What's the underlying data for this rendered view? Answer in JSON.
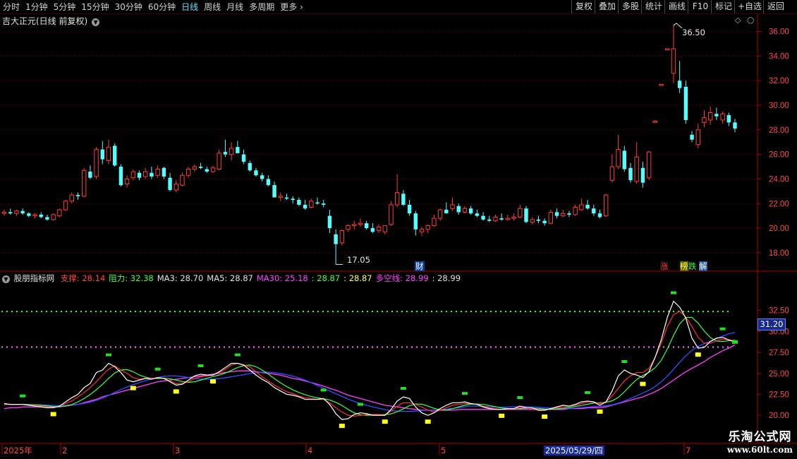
{
  "toolbar": {
    "periods": [
      "分时",
      "1分钟",
      "5分钟",
      "15分钟",
      "30分钟",
      "60分钟",
      "日线",
      "周线",
      "月线",
      "多周期",
      "更多"
    ],
    "selected": "日线",
    "right_buttons": [
      "复权",
      "叠加",
      "多股",
      "统计",
      "画线",
      "F10",
      "标记",
      "+自选",
      "返回"
    ]
  },
  "main_pane": {
    "title": "吉大正元(日线 前复权)",
    "y_ticks": [
      "36.00",
      "34.00",
      "32.00",
      "30.00",
      "28.00",
      "26.00",
      "24.00",
      "22.00",
      "20.00",
      "18.00"
    ],
    "high_label": "36.50",
    "low_label": "17.05",
    "markers": [
      "财",
      "涨",
      "榜",
      "跌",
      "解"
    ]
  },
  "indicator_pane": {
    "name": "股朋指标网",
    "labels": [
      {
        "text": "支撑: 28.14",
        "color": "#ff4040"
      },
      {
        "text": "阻力: 32.38",
        "color": "#40ff40"
      },
      {
        "text": "MA3: 28.70",
        "color": "#e0e0e0"
      },
      {
        "text": "MA5: 28.87",
        "color": "#e0e0e0"
      },
      {
        "text": "MA30: 25.18",
        "color": "#ff40ff"
      },
      {
        "text": ": 28.87",
        "color": "#40ff40"
      },
      {
        "text": ": 28.87",
        "color": "#ffff40"
      },
      {
        "text": "多空线: 28.99",
        "color": "#ff40ff"
      },
      {
        "text": ": 28.99",
        "color": "#e0e0e0"
      }
    ],
    "y_ticks": [
      "32.50",
      "30.00",
      "27.50",
      "25.00",
      "22.50",
      "20.00"
    ],
    "cursor_value": "31.20"
  },
  "time_axis": {
    "labels": [
      "2025年",
      "2",
      "3",
      "4",
      "5",
      "6",
      "7"
    ],
    "cursor_date": "2025/05/29/四"
  },
  "watermark": {
    "line1": "乐淘公式网",
    "line2": "www.60lt.com"
  },
  "colors": {
    "up": "#ff3b3b",
    "down": "#54ffff",
    "grid": "#7a0000",
    "axis": "#b00000"
  },
  "chart_data": {
    "type": "candlestick",
    "ohlc": [
      [
        21.2,
        21.5,
        21.0,
        21.3
      ],
      [
        21.3,
        21.6,
        21.1,
        21.2
      ],
      [
        21.2,
        21.5,
        21.0,
        21.4
      ],
      [
        21.4,
        21.6,
        21.1,
        21.2
      ],
      [
        21.2,
        21.3,
        20.9,
        21.0
      ],
      [
        21.0,
        21.2,
        20.8,
        21.1
      ],
      [
        21.1,
        21.3,
        20.8,
        20.9
      ],
      [
        20.9,
        21.1,
        20.6,
        20.7
      ],
      [
        20.7,
        21.2,
        20.6,
        21.1
      ],
      [
        21.0,
        21.6,
        20.9,
        21.5
      ],
      [
        21.5,
        22.3,
        21.4,
        22.2
      ],
      [
        22.2,
        22.9,
        22.0,
        22.7
      ],
      [
        22.7,
        22.9,
        22.3,
        22.6
      ],
      [
        22.6,
        24.9,
        22.5,
        24.7
      ],
      [
        24.6,
        25.1,
        24.0,
        24.1
      ],
      [
        24.2,
        26.6,
        24.0,
        26.4
      ],
      [
        26.4,
        27.1,
        25.2,
        25.6
      ],
      [
        25.5,
        27.2,
        25.2,
        26.6
      ],
      [
        26.7,
        26.9,
        25.0,
        25.1
      ],
      [
        25.0,
        25.2,
        23.4,
        23.5
      ],
      [
        23.6,
        24.3,
        23.3,
        24.0
      ],
      [
        24.1,
        24.8,
        23.9,
        24.6
      ],
      [
        24.5,
        24.7,
        23.9,
        24.1
      ],
      [
        24.2,
        24.9,
        24.0,
        24.6
      ],
      [
        24.5,
        25.0,
        24.0,
        24.2
      ],
      [
        24.3,
        25.1,
        24.1,
        24.8
      ],
      [
        24.9,
        25.0,
        24.0,
        24.2
      ],
      [
        24.1,
        24.5,
        23.0,
        23.1
      ],
      [
        23.1,
        23.9,
        22.9,
        23.6
      ],
      [
        23.5,
        24.5,
        23.4,
        24.3
      ],
      [
        24.3,
        25.0,
        24.1,
        24.8
      ],
      [
        24.8,
        25.2,
        24.6,
        25.0
      ],
      [
        25.0,
        25.3,
        24.8,
        24.9
      ],
      [
        24.8,
        25.0,
        24.5,
        24.6
      ],
      [
        24.6,
        25.1,
        24.5,
        24.9
      ],
      [
        24.8,
        26.4,
        24.7,
        26.1
      ],
      [
        26.2,
        27.2,
        25.8,
        26.0
      ],
      [
        26.0,
        27.0,
        25.5,
        26.5
      ],
      [
        26.6,
        27.1,
        26.2,
        26.1
      ],
      [
        26.0,
        26.4,
        25.2,
        25.4
      ],
      [
        25.3,
        25.5,
        24.6,
        24.7
      ],
      [
        24.7,
        24.9,
        24.2,
        24.3
      ],
      [
        24.3,
        24.5,
        23.8,
        24.0
      ],
      [
        24.0,
        24.3,
        23.4,
        23.5
      ],
      [
        23.5,
        23.8,
        22.6,
        22.5
      ],
      [
        22.5,
        22.9,
        22.2,
        22.6
      ],
      [
        22.5,
        22.8,
        22.3,
        22.4
      ],
      [
        22.4,
        22.6,
        22.0,
        22.3
      ],
      [
        22.3,
        22.5,
        21.8,
        21.9
      ],
      [
        21.9,
        22.3,
        21.5,
        21.6
      ],
      [
        21.7,
        22.4,
        21.6,
        22.2
      ],
      [
        22.1,
        22.5,
        21.9,
        22.0
      ],
      [
        22.0,
        22.3,
        21.7,
        21.9
      ],
      [
        21.0,
        21.5,
        19.6,
        20.0
      ],
      [
        19.5,
        19.9,
        17.05,
        18.7
      ],
      [
        18.8,
        19.9,
        18.6,
        19.8
      ],
      [
        19.9,
        20.3,
        19.7,
        20.2
      ],
      [
        20.2,
        20.6,
        19.9,
        20.3
      ],
      [
        20.3,
        20.8,
        20.1,
        20.4
      ],
      [
        20.4,
        20.6,
        19.9,
        20.0
      ],
      [
        20.0,
        20.4,
        19.6,
        19.7
      ],
      [
        19.8,
        20.3,
        19.6,
        20.1
      ],
      [
        19.7,
        20.2,
        19.5,
        20.2
      ],
      [
        20.3,
        22.2,
        20.2,
        21.9
      ],
      [
        21.9,
        24.4,
        21.7,
        22.9
      ],
      [
        22.8,
        23.1,
        21.8,
        21.9
      ],
      [
        21.9,
        22.3,
        21.0,
        21.2
      ],
      [
        21.2,
        21.4,
        19.4,
        19.9
      ],
      [
        19.7,
        20.1,
        19.4,
        19.9
      ],
      [
        19.9,
        20.3,
        19.6,
        20.2
      ],
      [
        20.2,
        21.1,
        20.1,
        20.8
      ],
      [
        20.8,
        21.6,
        20.6,
        21.5
      ],
      [
        21.5,
        22.1,
        21.3,
        21.2
      ],
      [
        21.6,
        22.5,
        21.4,
        21.9
      ],
      [
        21.8,
        22.0,
        21.1,
        21.3
      ],
      [
        21.3,
        21.8,
        21.2,
        21.6
      ],
      [
        21.6,
        21.8,
        21.1,
        21.2
      ],
      [
        21.2,
        21.5,
        20.9,
        21.0
      ],
      [
        21.0,
        21.3,
        20.6,
        20.7
      ],
      [
        20.7,
        21.0,
        20.5,
        20.6
      ],
      [
        20.6,
        21.1,
        20.5,
        20.9
      ],
      [
        20.8,
        21.2,
        20.6,
        20.7
      ],
      [
        20.7,
        21.1,
        20.6,
        20.8
      ],
      [
        20.8,
        21.2,
        20.6,
        20.9
      ],
      [
        20.9,
        21.9,
        20.8,
        21.6
      ],
      [
        21.6,
        21.8,
        20.4,
        20.5
      ],
      [
        20.5,
        20.9,
        20.3,
        20.7
      ],
      [
        20.7,
        21.0,
        20.4,
        20.6
      ],
      [
        20.6,
        20.8,
        20.2,
        20.4
      ],
      [
        20.4,
        21.5,
        20.3,
        21.3
      ],
      [
        21.3,
        21.6,
        20.8,
        21.0
      ],
      [
        21.0,
        21.5,
        20.9,
        21.2
      ],
      [
        21.2,
        21.4,
        20.9,
        21.1
      ],
      [
        21.1,
        21.9,
        21.0,
        21.7
      ],
      [
        21.5,
        22.4,
        21.4,
        21.9
      ],
      [
        21.9,
        22.3,
        21.5,
        21.6
      ],
      [
        21.6,
        21.9,
        21.0,
        21.2
      ],
      [
        21.2,
        21.5,
        20.8,
        20.9
      ],
      [
        21.0,
        22.8,
        20.9,
        22.7
      ],
      [
        23.9,
        26.0,
        23.7,
        25.0
      ],
      [
        25.0,
        27.6,
        24.8,
        26.4
      ],
      [
        26.3,
        26.7,
        24.6,
        24.8
      ],
      [
        24.9,
        25.3,
        23.7,
        23.9
      ],
      [
        23.8,
        27.0,
        23.6,
        25.8
      ],
      [
        24.9,
        25.4,
        23.3,
        23.7
      ],
      [
        24.1,
        26.3,
        23.9,
        26.2
      ],
      [
        28.6,
        28.8,
        28.6,
        28.7
      ],
      [
        31.6,
        31.7,
        31.6,
        31.7
      ],
      [
        34.5,
        34.6,
        34.5,
        34.6
      ],
      [
        32.6,
        36.5,
        31.8,
        34.6
      ],
      [
        32.0,
        33.6,
        31.0,
        31.4
      ],
      [
        31.5,
        32.0,
        28.5,
        28.8
      ],
      [
        27.6,
        27.9,
        27.0,
        27.2
      ],
      [
        26.8,
        28.5,
        26.5,
        28.0
      ],
      [
        28.6,
        29.6,
        28.2,
        29.0
      ],
      [
        28.8,
        29.9,
        28.4,
        29.4
      ],
      [
        29.3,
        29.8,
        28.8,
        29.1
      ],
      [
        28.8,
        29.5,
        28.5,
        29.3
      ],
      [
        29.2,
        29.4,
        28.3,
        28.6
      ],
      [
        28.6,
        28.9,
        27.8,
        28.1
      ]
    ],
    "indicator_series": {
      "MA3": [
        21.4,
        21.3,
        21.3,
        21.3,
        21.2,
        21.1,
        21.0,
        20.9,
        20.9,
        21.1,
        21.6,
        22.1,
        22.5,
        23.3,
        23.8,
        25.1,
        25.4,
        26.2,
        25.8,
        25.1,
        24.2,
        24.0,
        24.2,
        24.4,
        24.3,
        24.5,
        24.4,
        24.0,
        23.6,
        23.7,
        24.2,
        24.7,
        24.9,
        24.8,
        24.8,
        25.2,
        25.7,
        26.2,
        26.2,
        26.0,
        25.4,
        24.8,
        24.3,
        23.9,
        23.3,
        22.9,
        22.5,
        22.4,
        22.2,
        21.9,
        21.9,
        21.9,
        22.0,
        21.3,
        20.2,
        19.5,
        19.6,
        20.1,
        20.3,
        20.2,
        20.0,
        20.0,
        20.0,
        20.7,
        21.7,
        22.2,
        22.0,
        21.0,
        20.3,
        20.0,
        20.3,
        20.8,
        21.2,
        21.5,
        21.5,
        21.6,
        21.4,
        21.3,
        21.0,
        20.8,
        20.7,
        20.7,
        20.8,
        20.8,
        21.1,
        20.9,
        20.9,
        20.6,
        20.6,
        20.8,
        21.0,
        21.2,
        21.1,
        21.3,
        21.6,
        21.7,
        21.6,
        21.2,
        21.6,
        22.9,
        24.7,
        25.4,
        25.0,
        24.8,
        24.5,
        25.2,
        26.9,
        29.0,
        31.7,
        33.6,
        32.9,
        31.6,
        29.2,
        28.0,
        28.1,
        28.8,
        29.2,
        29.3,
        29.0,
        28.7
      ],
      "MA5": [
        21.3,
        21.3,
        21.3,
        21.3,
        21.2,
        21.2,
        21.1,
        21.0,
        20.9,
        21.1,
        21.4,
        21.7,
        22.2,
        22.7,
        23.3,
        24.0,
        24.8,
        25.5,
        25.9,
        25.4,
        25.0,
        24.5,
        24.3,
        24.4,
        24.4,
        24.5,
        24.4,
        24.1,
        23.8,
        23.8,
        24.0,
        24.4,
        24.6,
        24.7,
        24.8,
        25.1,
        25.5,
        26.0,
        26.2,
        26.0,
        25.8,
        25.2,
        24.6,
        24.1,
        23.6,
        23.2,
        22.8,
        22.6,
        22.3,
        22.1,
        22.0,
        21.9,
        21.9,
        21.5,
        20.9,
        20.4,
        20.0,
        19.9,
        20.0,
        20.1,
        20.1,
        20.1,
        20.0,
        20.5,
        21.1,
        21.5,
        21.5,
        21.3,
        21.0,
        20.6,
        20.4,
        20.6,
        20.9,
        21.2,
        21.3,
        21.4,
        21.4,
        21.3,
        21.1,
        20.9,
        20.8,
        20.7,
        20.8,
        20.8,
        20.9,
        20.9,
        20.8,
        20.7,
        20.6,
        20.8,
        20.9,
        21.0,
        21.1,
        21.2,
        21.4,
        21.6,
        21.6,
        21.4,
        21.6,
        22.3,
        23.2,
        24.1,
        24.7,
        25.1,
        25.1,
        25.6,
        26.9,
        28.6,
        30.6,
        32.0,
        32.4,
        31.7,
        30.6,
        29.3,
        28.6,
        28.6,
        28.9,
        29.1,
        29.0,
        28.9
      ],
      "MA30": [
        20.8,
        20.9,
        20.9,
        21.0,
        21.0,
        21.0,
        21.0,
        21.0,
        21.0,
        21.0,
        21.1,
        21.2,
        21.3,
        21.5,
        21.7,
        21.9,
        22.2,
        22.4,
        22.6,
        22.8,
        23.0,
        23.2,
        23.4,
        23.6,
        23.8,
        24.0,
        24.1,
        24.2,
        24.3,
        24.4,
        24.5,
        24.6,
        24.7,
        24.8,
        24.9,
        25.0,
        25.1,
        25.2,
        25.3,
        25.3,
        25.3,
        25.2,
        25.1,
        25.0,
        24.9,
        24.8,
        24.6,
        24.4,
        24.3,
        24.1,
        23.9,
        23.7,
        23.5,
        23.2,
        23.0,
        22.7,
        22.4,
        22.2,
        22.0,
        21.8,
        21.6,
        21.4,
        21.2,
        21.1,
        21.0,
        20.9,
        20.8,
        20.7,
        20.6,
        20.6,
        20.6,
        20.6,
        20.6,
        20.6,
        20.7,
        20.7,
        20.7,
        20.7,
        20.7,
        20.7,
        20.7,
        20.7,
        20.7,
        20.7,
        20.7,
        20.7,
        20.7,
        20.7,
        20.7,
        20.7,
        20.7,
        20.7,
        20.8,
        20.8,
        20.8,
        20.9,
        20.9,
        20.9,
        21.0,
        21.2,
        21.4,
        21.6,
        21.8,
        22.0,
        22.2,
        22.5,
        22.8,
        23.2,
        23.7,
        24.2,
        24.7,
        25.2,
        25.6,
        26.0,
        26.4,
        26.9,
        27.3,
        27.7,
        28.0,
        28.4
      ]
    },
    "support": 28.14,
    "resistance": 32.38
  }
}
